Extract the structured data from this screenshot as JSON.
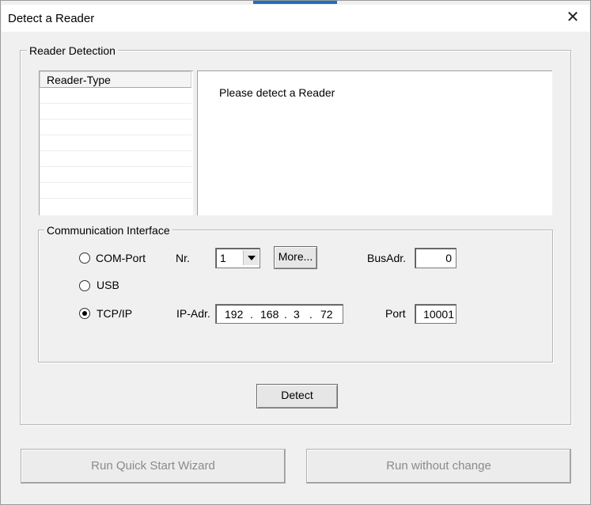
{
  "dialog": {
    "title": "Detect a Reader",
    "close_glyph": "✕"
  },
  "detection": {
    "group_label": "Reader Detection",
    "list_header": "Reader-Type",
    "message": "Please detect a Reader"
  },
  "comm": {
    "group_label": "Communication Interface",
    "options": [
      {
        "label": "COM-Port",
        "selected": false
      },
      {
        "label": "USB",
        "selected": false
      },
      {
        "label": "TCP/IP",
        "selected": true
      }
    ],
    "nr_label": "Nr.",
    "nr_value": "1",
    "more_label": "More...",
    "busadr_label": "BusAdr.",
    "busadr_value": "0",
    "ipadr_label": "IP-Adr.",
    "ip": [
      "192",
      "168",
      "3",
      "72"
    ],
    "ip_dot": ".",
    "port_label": "Port",
    "port_value": "10001"
  },
  "detect_button": "Detect",
  "footer": {
    "quick_start": "Run Quick Start Wizard",
    "without_change": "Run without change"
  }
}
